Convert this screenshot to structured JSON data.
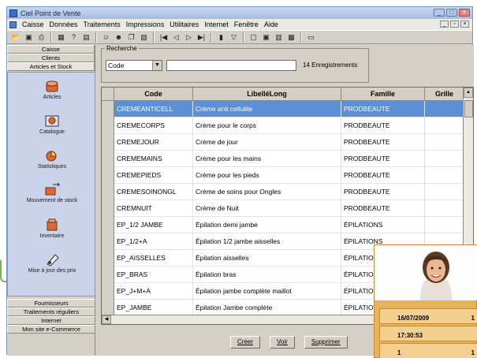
{
  "window": {
    "title": "Ciel Point de Vente",
    "controls": [
      "_",
      "□",
      "×"
    ]
  },
  "menu": [
    "Caisse",
    "Données",
    "Traitements",
    "Impressions",
    "Utilitaires",
    "Internet",
    "Fenêtre",
    "Aide"
  ],
  "sidebar": {
    "top_tabs": [
      "Caisse",
      "Clients",
      "Articles et Stock"
    ],
    "items": [
      {
        "label": "Articles",
        "icon": "articles-icon"
      },
      {
        "label": "Catalogue",
        "icon": "catalogue-icon"
      },
      {
        "label": "Statistiques",
        "icon": "statistiques-icon"
      },
      {
        "label": "Mouvement de stock",
        "icon": "stock-movement-icon"
      },
      {
        "label": "Inventaire",
        "icon": "inventaire-icon"
      },
      {
        "label": "Mise à jour des prix",
        "icon": "price-update-icon"
      }
    ],
    "bottom_tabs": [
      "Fournisseurs",
      "Traitements réguliers",
      "Internet",
      "Mon site e-Commerce"
    ]
  },
  "search": {
    "legend": "Recherche",
    "field_value": "Code",
    "input_value": "",
    "count_text": "14 Enregistrements"
  },
  "grid": {
    "columns": [
      "Code",
      "LibelléLong",
      "Famille",
      "Grille"
    ],
    "rows": [
      {
        "code": "CREMEANTICELL",
        "libelle": "Crème anti cellulite",
        "famille": "PRODBEAUTE"
      },
      {
        "code": "CREMECORPS",
        "libelle": "Crème pour le corps",
        "famille": "PRODBEAUTE"
      },
      {
        "code": "CREMEJOUR",
        "libelle": "Crème de jour",
        "famille": "PRODBEAUTE"
      },
      {
        "code": "CREMEMAINS",
        "libelle": "Crème pour les mains",
        "famille": "PRODBEAUTE"
      },
      {
        "code": "CREMEPIEDS",
        "libelle": "Crème pour les pieds",
        "famille": "PRODBEAUTE"
      },
      {
        "code": "CREMESOINONGL",
        "libelle": "Crème de soins pour Ongles",
        "famille": "PRODBEAUTE"
      },
      {
        "code": "CREMNUIT",
        "libelle": "Crème de Nuit",
        "famille": "PRODBEAUTE"
      },
      {
        "code": "EP_1/2 JAMBE",
        "libelle": "Épilation demi jambe",
        "famille": "ÉPILATIONS"
      },
      {
        "code": "EP_1/2+A",
        "libelle": "Épilation 1/2 jambe aisselles",
        "famille": "ÉPILATIONS"
      },
      {
        "code": "EP_AISSELLES",
        "libelle": "Épilation aisselles",
        "famille": "ÉPILATIONS"
      },
      {
        "code": "EP_BRAS",
        "libelle": "Épilation bras",
        "famille": "ÉPILATIONS"
      },
      {
        "code": "EP_J+M+A",
        "libelle": "Épilation jambe complète maillot",
        "famille": "ÉPILATIONS"
      },
      {
        "code": "EP_JAMBE",
        "libelle": "Épilation Jambe complète",
        "famille": "ÉPILATIONS"
      }
    ],
    "selected_index": 0
  },
  "buttons": {
    "create": "Créer",
    "view": "Voir",
    "delete": "Supprimer"
  },
  "card": {
    "date": "16/07/2009",
    "time": "17:30:53",
    "val_a": "1",
    "val_b": "1",
    "val_c": "1",
    "val_d": "1"
  },
  "colors": {
    "selection": "#5b8fd6",
    "sidebar_panel": "#c9d3ea",
    "card": "#e6b25a",
    "accent_green": "#7ab648"
  }
}
